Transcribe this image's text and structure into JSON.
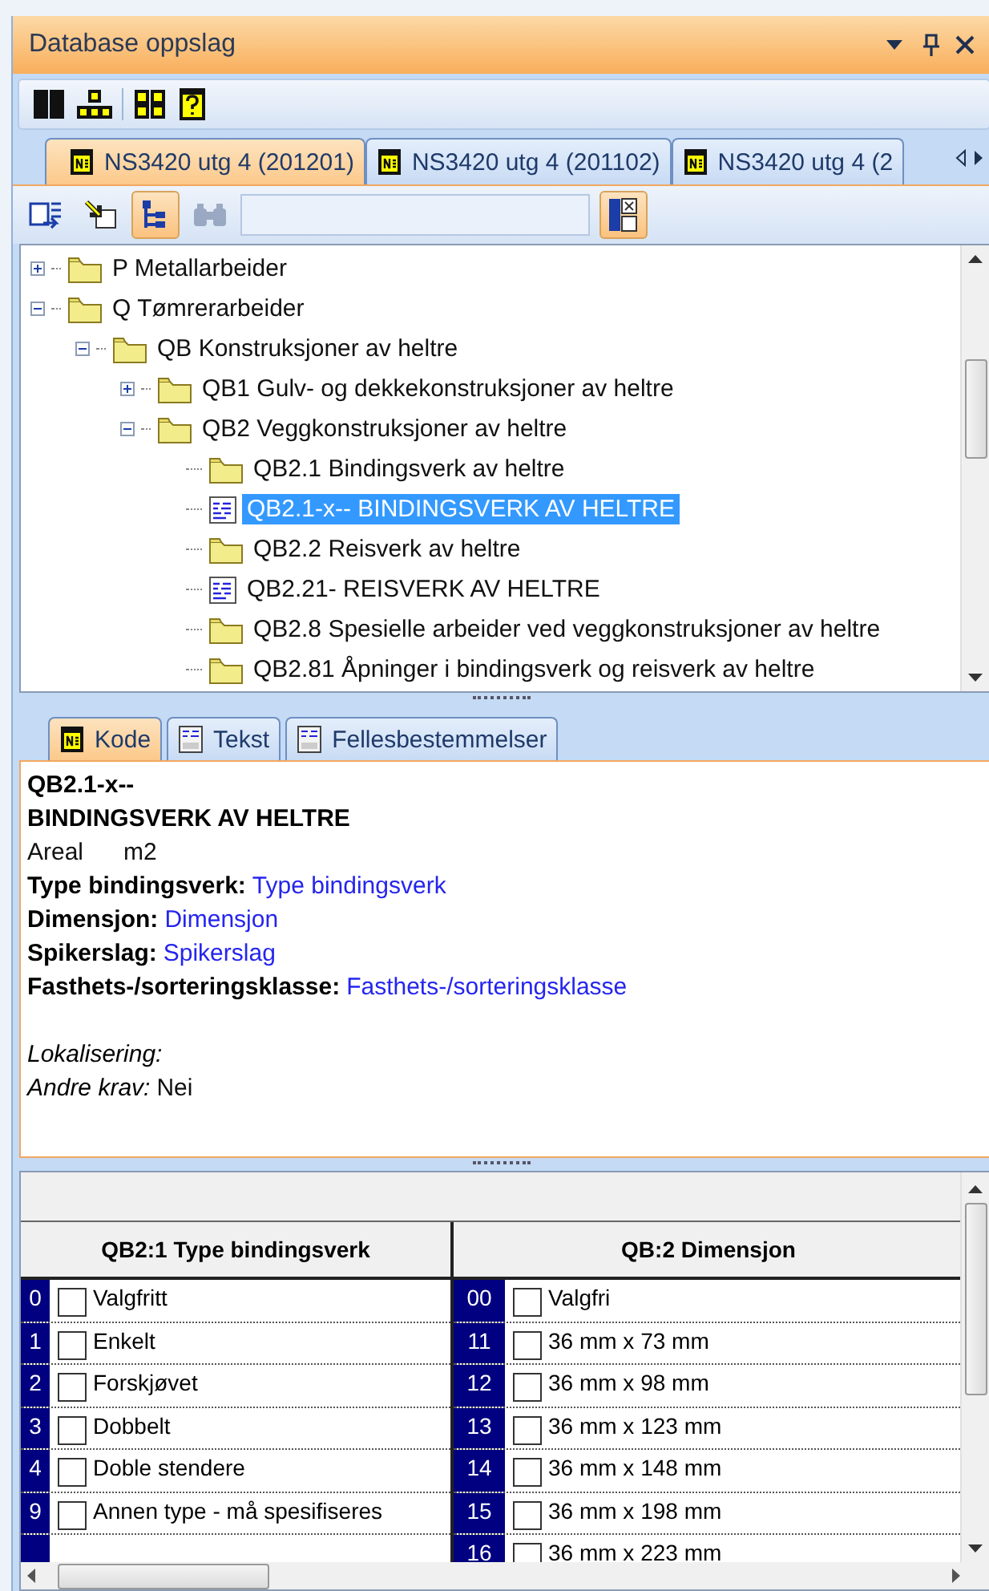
{
  "window": {
    "title": "Database oppslag"
  },
  "doc_tabs": [
    {
      "label": "NS3420 utg 4 (201201)",
      "selected": true
    },
    {
      "label": "NS3420 utg 4 (201102)",
      "selected": false
    },
    {
      "label": "NS3420 utg 4 (2",
      "selected": false
    }
  ],
  "tool_buttons": [
    {
      "pressed": false,
      "disabled": false
    },
    {
      "pressed": false,
      "disabled": false
    },
    {
      "pressed": true,
      "disabled": false
    },
    {
      "pressed": false,
      "disabled": true
    }
  ],
  "search": {
    "toggle_pressed": true
  },
  "tree": [
    {
      "label": "P Metallarbeider",
      "kind": "folder",
      "expanded": false,
      "selected": false
    },
    {
      "label": "Q Tømrerarbeider",
      "kind": "folder",
      "expanded": true,
      "selected": false,
      "children": [
        {
          "label": "QB Konstruksjoner av heltre",
          "kind": "folder",
          "expanded": true,
          "selected": false,
          "children": [
            {
              "label": "QB1 Gulv- og dekkekonstruksjoner av heltre",
              "kind": "folder",
              "expanded": false,
              "selected": false
            },
            {
              "label": "QB2 Veggkonstruksjoner av heltre",
              "kind": "folder",
              "expanded": true,
              "selected": false,
              "children": [
                {
                  "label": "QB2.1 Bindingsverk av heltre",
                  "kind": "folder",
                  "selected": false
                },
                {
                  "label": "QB2.1-x-- BINDINGSVERK AV HELTRE",
                  "kind": "document",
                  "selected": true
                },
                {
                  "label": "QB2.2 Reisverk av heltre",
                  "kind": "folder",
                  "selected": false
                },
                {
                  "label": "QB2.21- REISVERK AV HELTRE",
                  "kind": "document",
                  "selected": false
                },
                {
                  "label": "QB2.8 Spesielle arbeider ved veggkonstruksjoner av heltre",
                  "kind": "folder",
                  "selected": false
                },
                {
                  "label": "QB2.81 Åpninger i bindingsverk og reisverk av heltre",
                  "kind": "folder",
                  "selected": false
                }
              ]
            }
          ]
        }
      ]
    }
  ],
  "detail_tabs": [
    {
      "label": "Kode",
      "kind": "code",
      "selected": true
    },
    {
      "label": "Tekst",
      "kind": "text",
      "selected": false
    },
    {
      "label": "Fellesbestemmelser",
      "kind": "text",
      "selected": false
    }
  ],
  "detail": {
    "code": "QB2.1-x--",
    "title": "BINDINGSVERK AV HELTRE",
    "unit_label": "Areal",
    "unit": "m2",
    "fields": [
      {
        "label": "Type bindingsverk:",
        "value": "Type bindingsverk"
      },
      {
        "label": "Dimensjon:",
        "value": "Dimensjon"
      },
      {
        "label": "Spikerslag:",
        "value": "Spikerslag"
      },
      {
        "label": "Fasthets-/sorteringsklasse:",
        "value": "Fasthets-/sorteringsklasse"
      }
    ],
    "notes": [
      {
        "label": "Lokalisering:"
      },
      {
        "label": "Andre krav:",
        "value": "Nei"
      }
    ]
  },
  "table": {
    "columns": [
      {
        "header": "QB2:1 Type bindingsverk",
        "rows": [
          {
            "code": "0",
            "label": "Valgfritt",
            "checked": false
          },
          {
            "code": "1",
            "label": "Enkelt",
            "checked": false
          },
          {
            "code": "2",
            "label": "Forskjøvet",
            "checked": false
          },
          {
            "code": "3",
            "label": "Dobbelt",
            "checked": false
          },
          {
            "code": "4",
            "label": "Doble stendere",
            "checked": false
          },
          {
            "code": "9",
            "label": "Annen type - må spesifiseres",
            "checked": false
          },
          {
            "kind": "empty"
          }
        ]
      },
      {
        "header": "QB:2 Dimensjon",
        "rows": [
          {
            "code": "00",
            "label": "Valgfri",
            "checked": false
          },
          {
            "code": "11",
            "label": "36 mm x 73 mm",
            "checked": false
          },
          {
            "code": "12",
            "label": "36 mm x 98 mm",
            "checked": false
          },
          {
            "code": "13",
            "label": "36 mm x 123 mm",
            "checked": false
          },
          {
            "code": "14",
            "label": "36 mm x 148 mm",
            "checked": false
          },
          {
            "code": "15",
            "label": "36 mm x 198 mm",
            "checked": false
          },
          {
            "code": "16",
            "label": "36 mm x 223 mm",
            "checked": false
          }
        ]
      }
    ]
  }
}
